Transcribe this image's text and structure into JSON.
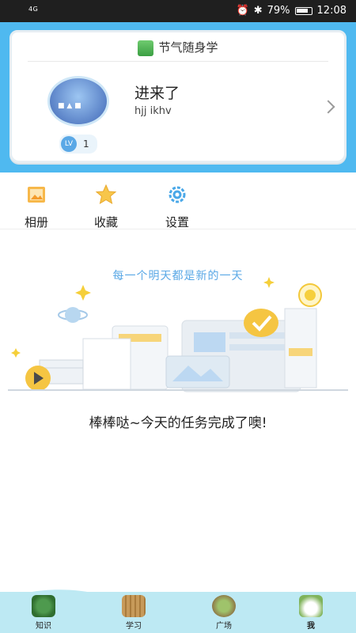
{
  "status": {
    "left_text": "4G",
    "battery_text": "79%",
    "time": "12:08"
  },
  "card": {
    "app_name": "节气随身学",
    "user_name": "进来了",
    "user_handle": "hjj ikhv",
    "level_label": "LV",
    "level_value": "1"
  },
  "quick": [
    {
      "label": "相册",
      "icon": "album-icon"
    },
    {
      "label": "收藏",
      "icon": "star-icon"
    },
    {
      "label": "设置",
      "icon": "gear-icon"
    }
  ],
  "content": {
    "slogan": "每一个明天都是新的一天",
    "message": "棒棒哒~今天的任务完成了噢!"
  },
  "nav": [
    {
      "label": "知识",
      "icon": "knowledge-icon"
    },
    {
      "label": "学习",
      "icon": "study-icon"
    },
    {
      "label": "广场",
      "icon": "square-icon"
    },
    {
      "label": "我",
      "icon": "me-icon"
    }
  ],
  "colors": {
    "header_blue": "#4fb9f0",
    "accent_blue": "#5aa8e6",
    "nav_bg": "#bde9f3"
  }
}
